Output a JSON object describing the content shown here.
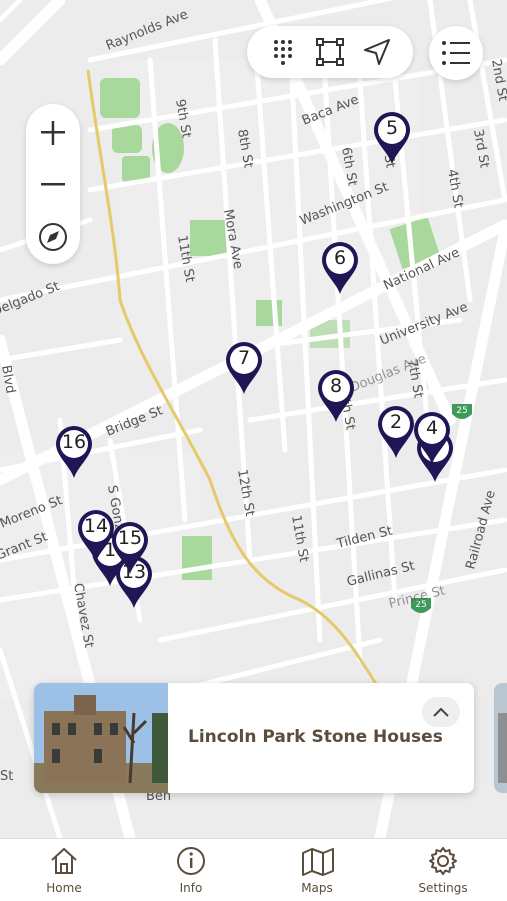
{
  "map": {
    "streets": [
      "Raynolds Ave",
      "9th St",
      "8th St",
      "Baca Ave",
      "6th St",
      "5th St",
      "4th St",
      "3rd St",
      "2nd St",
      "Washington St",
      "11th St",
      "Mora Ave",
      "National Ave",
      "University Ave",
      "7th St",
      "Bridge St",
      "S Gonzales",
      "12th St",
      "8th St",
      "Moreno St",
      "Grant St",
      "Tilden St",
      "11th St",
      "Gallinas St",
      "Chavez St",
      "Railroad Ave",
      "Blvd",
      "Delgado St",
      "Douglas Ave",
      "Prince St",
      "St",
      "Ben"
    ],
    "highway_shields": [
      "25",
      "25"
    ],
    "markers": [
      "5",
      "6",
      "7",
      "8",
      "2",
      "4",
      "",
      "16",
      "14",
      "1",
      "15",
      "13"
    ]
  },
  "controls": {
    "grid_icon": "grid-icon",
    "select_icon": "square-select-icon",
    "locate_icon": "navigation-arrow-icon",
    "list_icon": "list-icon",
    "zoom_in": "+",
    "zoom_out": "−",
    "compass_icon": "compass-icon"
  },
  "card": {
    "title": "Lincoln Park Stone Houses",
    "expand_icon": "chevron-up-icon"
  },
  "nav": [
    {
      "label": "Home",
      "icon": "home-icon"
    },
    {
      "label": "Info",
      "icon": "info-icon"
    },
    {
      "label": "Maps",
      "icon": "map-icon"
    },
    {
      "label": "Settings",
      "icon": "gear-icon"
    }
  ],
  "colors": {
    "pin": "#1f1656",
    "park": "#a7d79a",
    "accent": "#5a4d3d",
    "river": "#e6c96a"
  }
}
